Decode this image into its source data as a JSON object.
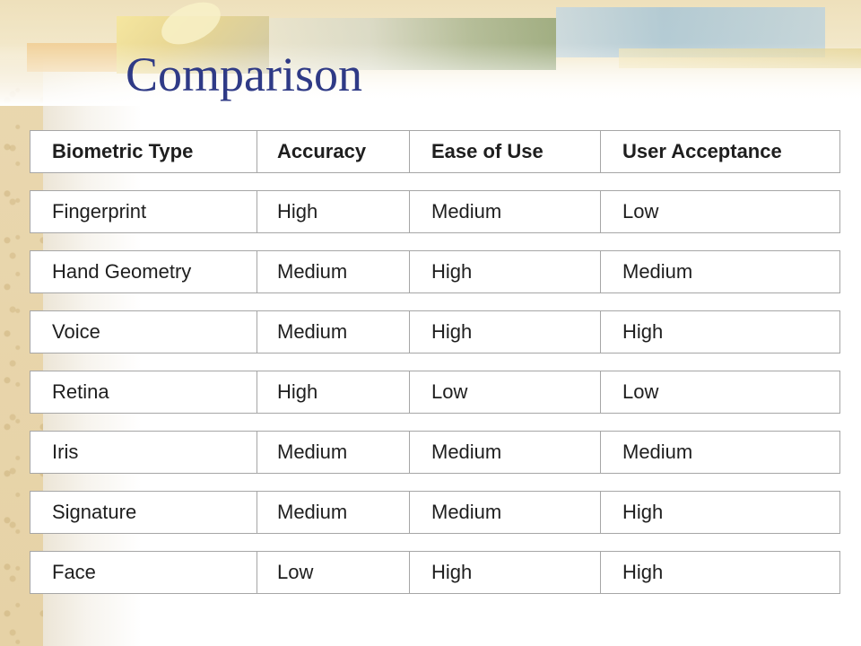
{
  "slide": {
    "title": "Comparison"
  },
  "table": {
    "headers": [
      "Biometric Type",
      "Accuracy",
      "Ease of Use",
      "User Acceptance"
    ],
    "rows": [
      [
        "Fingerprint",
        "High",
        "Medium",
        "Low"
      ],
      [
        "Hand Geometry",
        "Medium",
        "High",
        "Medium"
      ],
      [
        "Voice",
        "Medium",
        "High",
        "High"
      ],
      [
        "Retina",
        "High",
        "Low",
        "Low"
      ],
      [
        "Iris",
        "Medium",
        "Medium",
        "Medium"
      ],
      [
        "Signature",
        "Medium",
        "Medium",
        "High"
      ],
      [
        "Face",
        "Low",
        "High",
        "High"
      ]
    ]
  },
  "colors": {
    "title": "#2f3a86",
    "background_accent": "#ead8b0",
    "table_border": "#a6a6a6"
  }
}
